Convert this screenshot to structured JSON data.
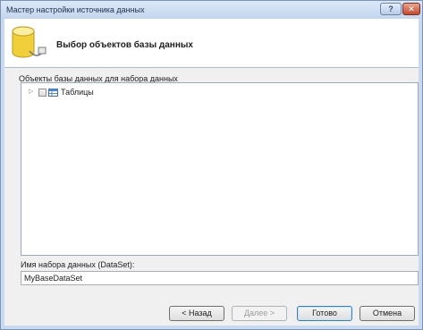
{
  "window": {
    "title": "Мастер настройки источника данных",
    "help_label": "?",
    "close_label": "✕"
  },
  "header": {
    "title": "Выбор объектов базы данных",
    "icon": "database-icon"
  },
  "tree": {
    "label": "Объекты базы данных для набора данных",
    "items": [
      {
        "label": "Таблицы",
        "expanded": false,
        "checked": false,
        "icon": "tables-icon"
      }
    ]
  },
  "dataset": {
    "label": "Имя набора данных (DataSet):",
    "value": "MyBaseDataSet"
  },
  "buttons": {
    "back": "< Назад",
    "next": "Далее >",
    "finish": "Готово",
    "cancel": "Отмена"
  },
  "colors": {
    "titlebar": "#c3d6ee",
    "close": "#c44830",
    "body": "#f0f0f0"
  }
}
